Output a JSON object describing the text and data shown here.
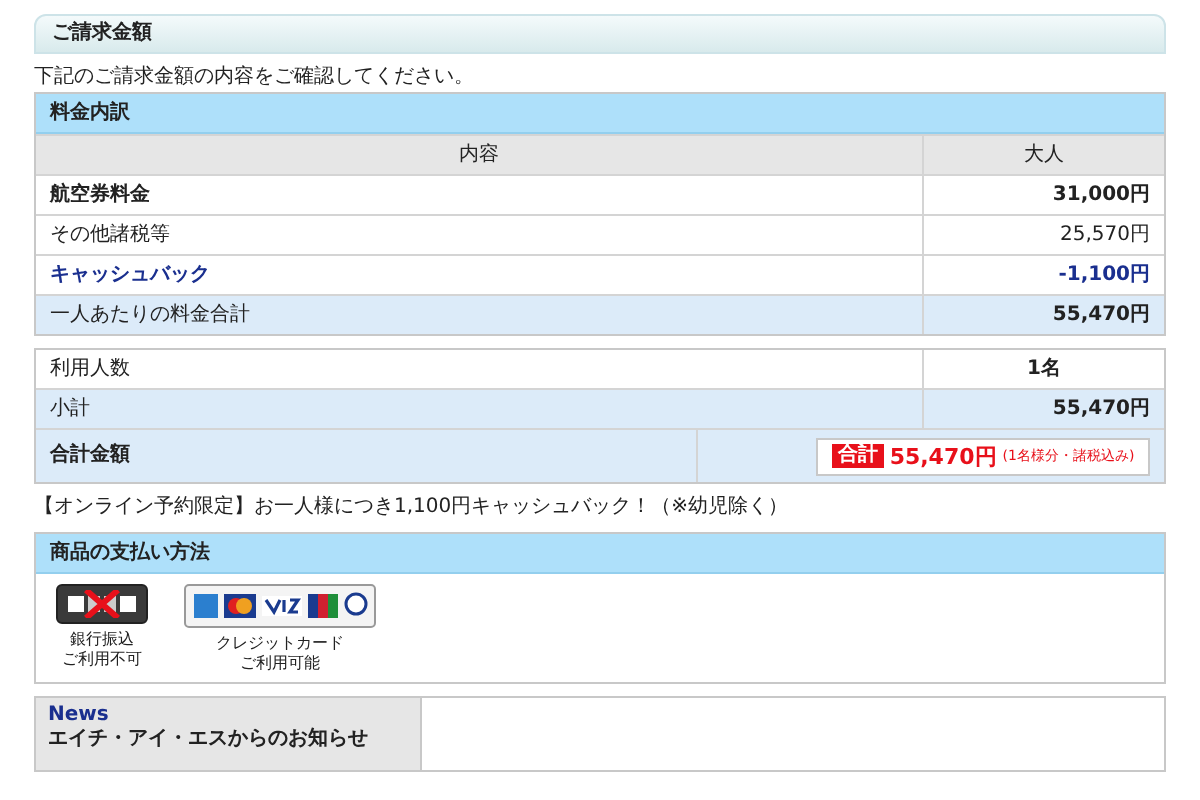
{
  "section_title": "ご請求金額",
  "intro": "下記のご請求金額の内容をご確認してください。",
  "breakdown": {
    "title": "料金内訳",
    "columns": [
      "内容",
      "大人"
    ],
    "rows": [
      {
        "kind": "bold",
        "label": "航空券料金",
        "value": "31,000円"
      },
      {
        "kind": "normal",
        "label": "その他諸税等",
        "value": "25,570円"
      },
      {
        "kind": "highlight",
        "label": "キャッシュバック",
        "value": "-1,100円"
      },
      {
        "kind": "summary",
        "label": "一人あたりの料金合計",
        "value": "55,470円"
      }
    ]
  },
  "totals": {
    "rows": [
      {
        "kind": "count",
        "label": "利用人数",
        "value": "1名"
      },
      {
        "kind": "summary",
        "label": "小計",
        "value": "55,470円"
      }
    ],
    "grand": {
      "label": "合計金額",
      "badge": "合計",
      "amount": "55,470円",
      "note": "(1名様分・諸税込み)"
    }
  },
  "promo": "【オンライン予約限定】お一人様につき1,100円キャッシュバック！（※幼児除く）",
  "payment": {
    "title": "商品の支払い方法",
    "methods": [
      {
        "kind": "bank",
        "disabled": true,
        "caption": [
          "銀行振込",
          "ご利用不可"
        ]
      },
      {
        "kind": "card",
        "disabled": false,
        "caption": [
          "クレジットカード",
          "ご利用可能"
        ]
      }
    ]
  },
  "news": {
    "heading": "News",
    "text": "エイチ・アイ・エスからのお知らせ"
  }
}
